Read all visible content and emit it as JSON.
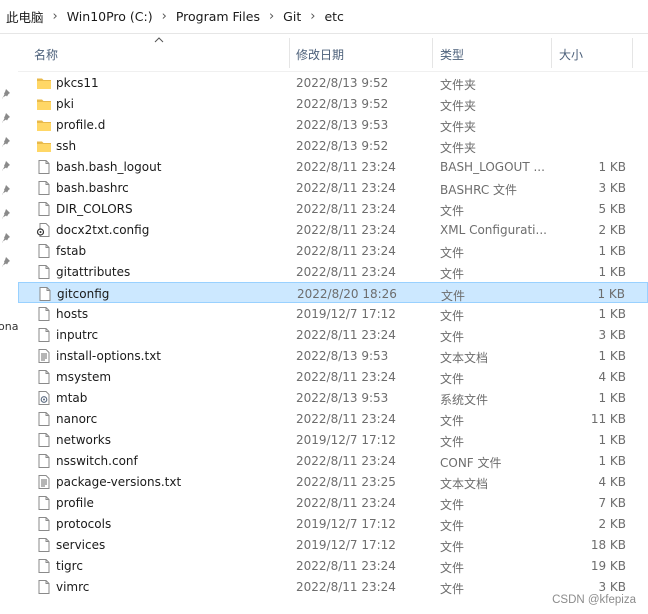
{
  "breadcrumb": [
    "此电脑",
    "Win10Pro (C:)",
    "Program Files",
    "Git",
    "etc"
  ],
  "breadcrumb_separator": "›",
  "nav_fragment": "ona",
  "columns": {
    "name": "名称",
    "date": "修改日期",
    "type": "类型",
    "size": "大小"
  },
  "files": [
    {
      "name": "pkcs11",
      "date": "2022/8/13 9:52",
      "type": "文件夹",
      "size": "",
      "icon": "folder-icon"
    },
    {
      "name": "pki",
      "date": "2022/8/13 9:52",
      "type": "文件夹",
      "size": "",
      "icon": "folder-icon"
    },
    {
      "name": "profile.d",
      "date": "2022/8/13 9:53",
      "type": "文件夹",
      "size": "",
      "icon": "folder-icon"
    },
    {
      "name": "ssh",
      "date": "2022/8/13 9:52",
      "type": "文件夹",
      "size": "",
      "icon": "folder-icon"
    },
    {
      "name": "bash.bash_logout",
      "date": "2022/8/11 23:24",
      "type": "BASH_LOGOUT ...",
      "size": "1 KB",
      "icon": "file-icon"
    },
    {
      "name": "bash.bashrc",
      "date": "2022/8/11 23:24",
      "type": "BASHRC 文件",
      "size": "3 KB",
      "icon": "file-icon"
    },
    {
      "name": "DIR_COLORS",
      "date": "2022/8/11 23:24",
      "type": "文件",
      "size": "5 KB",
      "icon": "file-icon"
    },
    {
      "name": "docx2txt.config",
      "date": "2022/8/11 23:24",
      "type": "XML Configurati...",
      "size": "2 KB",
      "icon": "config-file-icon"
    },
    {
      "name": "fstab",
      "date": "2022/8/11 23:24",
      "type": "文件",
      "size": "1 KB",
      "icon": "file-icon"
    },
    {
      "name": "gitattributes",
      "date": "2022/8/11 23:24",
      "type": "文件",
      "size": "1 KB",
      "icon": "file-icon"
    },
    {
      "name": "gitconfig",
      "date": "2022/8/20 18:26",
      "type": "文件",
      "size": "1 KB",
      "icon": "file-icon",
      "selected": true
    },
    {
      "name": "hosts",
      "date": "2019/12/7 17:12",
      "type": "文件",
      "size": "1 KB",
      "icon": "file-icon"
    },
    {
      "name": "inputrc",
      "date": "2022/8/11 23:24",
      "type": "文件",
      "size": "3 KB",
      "icon": "file-icon"
    },
    {
      "name": "install-options.txt",
      "date": "2022/8/13 9:53",
      "type": "文本文档",
      "size": "1 KB",
      "icon": "text-file-icon"
    },
    {
      "name": "msystem",
      "date": "2022/8/11 23:24",
      "type": "文件",
      "size": "4 KB",
      "icon": "file-icon"
    },
    {
      "name": "mtab",
      "date": "2022/8/13 9:53",
      "type": "系统文件",
      "size": "1 KB",
      "icon": "system-file-icon"
    },
    {
      "name": "nanorc",
      "date": "2022/8/11 23:24",
      "type": "文件",
      "size": "11 KB",
      "icon": "file-icon"
    },
    {
      "name": "networks",
      "date": "2019/12/7 17:12",
      "type": "文件",
      "size": "1 KB",
      "icon": "file-icon"
    },
    {
      "name": "nsswitch.conf",
      "date": "2022/8/11 23:24",
      "type": "CONF 文件",
      "size": "1 KB",
      "icon": "file-icon"
    },
    {
      "name": "package-versions.txt",
      "date": "2022/8/11 23:25",
      "type": "文本文档",
      "size": "4 KB",
      "icon": "text-file-icon"
    },
    {
      "name": "profile",
      "date": "2022/8/11 23:24",
      "type": "文件",
      "size": "7 KB",
      "icon": "file-icon"
    },
    {
      "name": "protocols",
      "date": "2019/12/7 17:12",
      "type": "文件",
      "size": "2 KB",
      "icon": "file-icon"
    },
    {
      "name": "services",
      "date": "2019/12/7 17:12",
      "type": "文件",
      "size": "18 KB",
      "icon": "file-icon"
    },
    {
      "name": "tigrc",
      "date": "2022/8/11 23:24",
      "type": "文件",
      "size": "19 KB",
      "icon": "file-icon"
    },
    {
      "name": "vimrc",
      "date": "2022/8/11 23:24",
      "type": "文件",
      "size": "3 KB",
      "icon": "file-icon"
    }
  ],
  "watermark": "CSDN @kfepiza",
  "colors": {
    "folder": "#ffd766",
    "selection_bg": "#cce8ff",
    "selection_border": "#99d1ff",
    "header_text": "#4c607a"
  }
}
